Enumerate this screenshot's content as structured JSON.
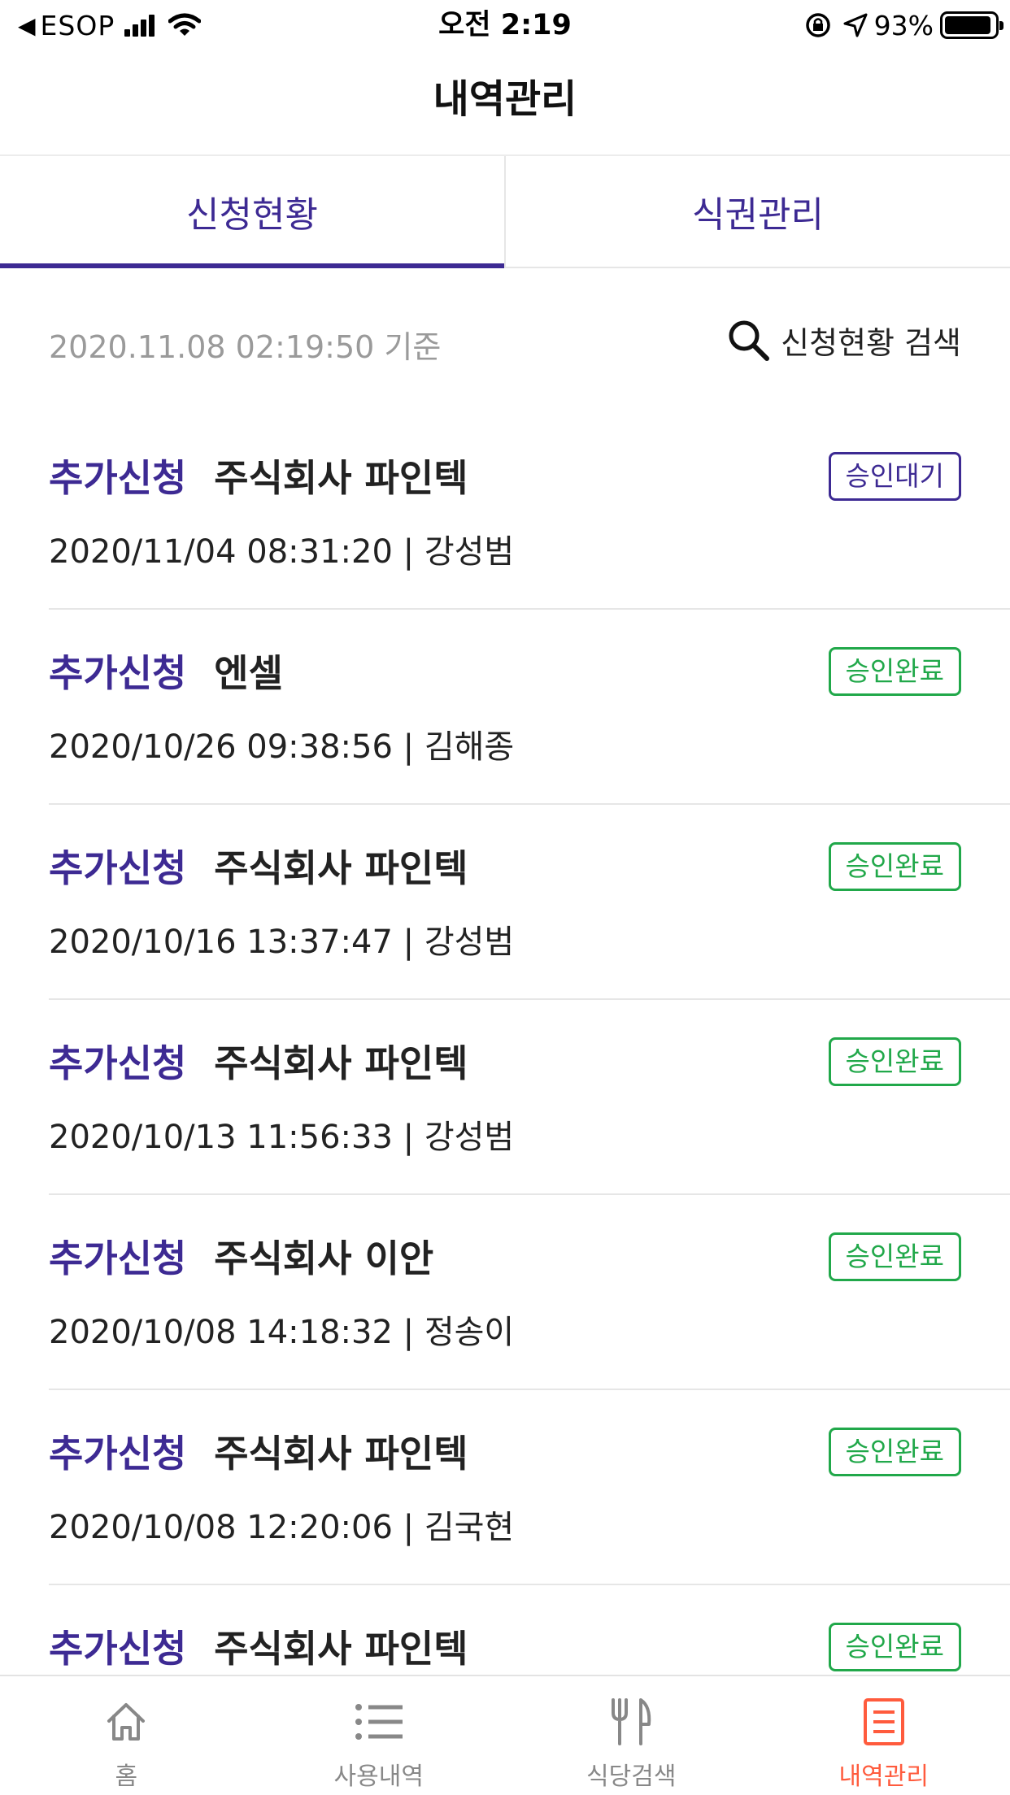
{
  "status_bar": {
    "back_label": "◀",
    "carrier": "ESOP",
    "time": "오전 2:19",
    "battery_percent_text": "93%",
    "battery_level": 0.93
  },
  "header": {
    "title": "내역관리"
  },
  "tabs": [
    {
      "label": "신청현황",
      "active": true
    },
    {
      "label": "식권관리",
      "active": false
    }
  ],
  "info": {
    "as_of": "2020.11.08 02:19:50 기준",
    "search_label": "신청현황 검색"
  },
  "items": [
    {
      "type": "추가신청",
      "company": "주식회사 파인텍",
      "meta": "2020/11/04 08:31:20 | 강성범",
      "status": "승인대기",
      "status_kind": "pending"
    },
    {
      "type": "추가신청",
      "company": "엔셀",
      "meta": "2020/10/26 09:38:56 | 김해종",
      "status": "승인완료",
      "status_kind": "done"
    },
    {
      "type": "추가신청",
      "company": "주식회사 파인텍",
      "meta": "2020/10/16 13:37:47 | 강성범",
      "status": "승인완료",
      "status_kind": "done"
    },
    {
      "type": "추가신청",
      "company": "주식회사 파인텍",
      "meta": "2020/10/13 11:56:33 | 강성범",
      "status": "승인완료",
      "status_kind": "done"
    },
    {
      "type": "추가신청",
      "company": "주식회사 이안",
      "meta": "2020/10/08 14:18:32 | 정송이",
      "status": "승인완료",
      "status_kind": "done"
    },
    {
      "type": "추가신청",
      "company": "주식회사 파인텍",
      "meta": "2020/10/08 12:20:06 | 김국현",
      "status": "승인완료",
      "status_kind": "done"
    },
    {
      "type": "추가신청",
      "company": "주식회사 파인텍",
      "meta": "",
      "status": "승인완료",
      "status_kind": "done"
    }
  ],
  "bottom_nav": [
    {
      "label": "홈",
      "icon": "home-icon",
      "active": false
    },
    {
      "label": "사용내역",
      "icon": "list-icon",
      "active": false
    },
    {
      "label": "식당검색",
      "icon": "fork-knife-icon",
      "active": false
    },
    {
      "label": "내역관리",
      "icon": "document-icon",
      "active": true
    }
  ],
  "colors": {
    "primary": "#3d2a93",
    "pending": "#3d2a93",
    "approved": "#21a84a",
    "nav_active": "#ff5b3d",
    "nav_inactive": "#888888"
  }
}
